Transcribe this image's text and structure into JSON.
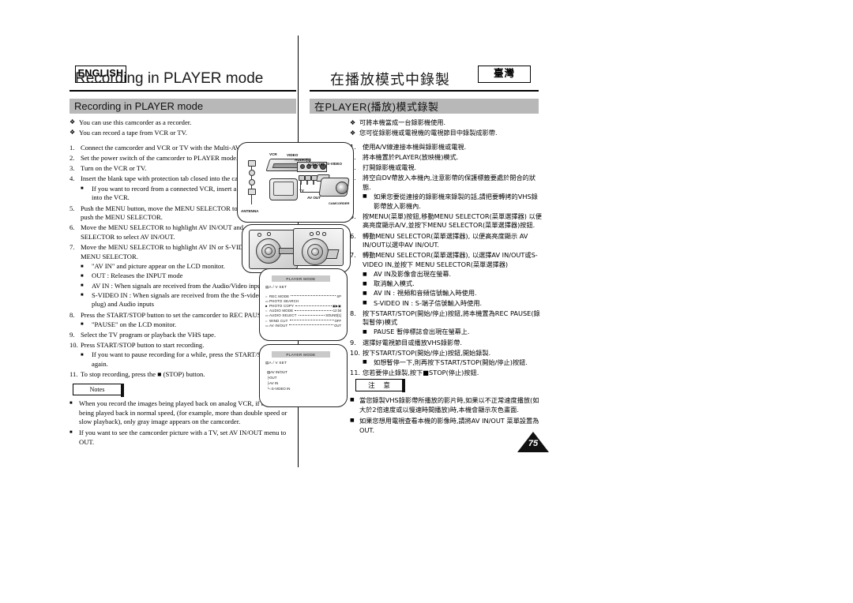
{
  "page": {
    "number": "75",
    "english_badge": "ENGLISH",
    "taiwan_badge": "臺灣"
  },
  "english": {
    "title": "Recording in PLAYER mode",
    "section_bar": "Recording in PLAYER mode",
    "intro_bullets": [
      "You can use this camcorder as a recorder.",
      "You can record a tape from VCR or TV."
    ],
    "steps": [
      {
        "num": "1.",
        "text": "Connect the camcorder and VCR or TV with the Multi-AV cable.",
        "subs": []
      },
      {
        "num": "2.",
        "text": "Set the power switch of the camcorder to PLAYER mode.",
        "subs": []
      },
      {
        "num": "3.",
        "text": "Turn on the VCR or TV.",
        "subs": []
      },
      {
        "num": "4.",
        "text": "Insert the blank tape with protection tab closed into the camcorder.",
        "subs": [
          "If you want to record from a connected VCR, insert a recorded VHS tape into the VCR."
        ]
      },
      {
        "num": "5.",
        "text": "Push the MENU button, move the MENU SELECTOR to highlight A/V and push the MENU SELECTOR.",
        "subs": []
      },
      {
        "num": "6.",
        "text": "Move the MENU SELECTOR to highlight AV IN/OUT and push the MENU SELECTOR to select AV IN/OUT.",
        "subs": []
      },
      {
        "num": "7.",
        "text": "Move the MENU SELECTOR to highlight AV IN or S-VIDEO IN and push the MENU SELECTOR.",
        "subs": [
          "\"AV IN\" and picture appear on the LCD monitor.",
          "OUT : Releases the INPUT mode",
          "AV IN : When signals are received from the Audio/Video input jacks",
          "S-VIDEO IN : When signals are received from the the S-video (S-Jack plug) and Audio inputs"
        ]
      },
      {
        "num": "8.",
        "text": "Press the START/STOP button to set the camcorder to REC PAUSE mode.",
        "subs": [
          "\"PAUSE\" on the LCD monitor."
        ]
      },
      {
        "num": "9.",
        "text": "Select the TV program or playback the VHS tape.",
        "subs": []
      },
      {
        "num": "10.",
        "text": "Press START/STOP button to start recording.",
        "subs": [
          "If you want to pause recording for a while, press the START/STOP button again."
        ]
      },
      {
        "num": "11.",
        "text": "To stop recording, press the ■ (STOP) button.",
        "subs": []
      }
    ],
    "notes_label": "Notes",
    "notes": [
      "When you record the images being played back on analog VCR, if they are not being played back in normal speed, (for example, more than double speed or slow playback), only gray image appears on the camcorder.",
      "If you want to see the camcorder picture with a TV, set AV IN/OUT menu to OUT."
    ]
  },
  "chinese": {
    "title": "在播放模式中錄製",
    "section_bar": "在PLAYER(播放)模式錄製",
    "intro_bullets": [
      "可將本機當成一台錄影機使用.",
      "您可從錄影機或電視機的電視節目中錄製成影帶."
    ],
    "steps": [
      {
        "num": "1.",
        "text": "使用A/V線連接本機與錄影機或電視.",
        "subs": []
      },
      {
        "num": "2.",
        "text": "將本機置於PLAYER(放映機)模式.",
        "subs": []
      },
      {
        "num": "3.",
        "text": "打開錄影機或電視.",
        "subs": []
      },
      {
        "num": "4.",
        "text": "將空白DV帶放入本機內,注意影帶的保護標籤要處於閉合的狀態.",
        "subs": [
          "如果您要從連接的錄影機來錄製的話,請把要轉拷的VHS錄影帶放入影機內."
        ]
      },
      {
        "num": "5.",
        "text": "按MENU(菜單)按鈕,移動MENU SELECTOR(菜單選擇器) 以便高亮度顯示A/V,並按下MENU SELECTOR(菜單選擇器)按鈕.",
        "subs": []
      },
      {
        "num": "6.",
        "text": "轉動MENU SELECTOR(菜單選擇器), 以便高亮度顯示 AV IN/OUT以選中AV IN/OUT.",
        "subs": []
      },
      {
        "num": "7.",
        "text": "轉動MENU SELECTOR(菜單選擇器), 以選擇AV IN/OUT或S-VIDEO IN,並按下 MENU SELECTOR(菜單選擇器)",
        "subs": [
          "AV IN及影像會出現在螢幕.",
          "取消輸入模式.",
          "AV IN : 視頻和音頻信號輸入時使用.",
          "S-VIDEO IN : S-端子信號輸入時使用."
        ]
      },
      {
        "num": "8.",
        "text": "按下START/STOP(開始/停止)按鈕,將本機置為REC PAUSE(錄製暫停)模式",
        "subs": [
          "PAUSE 暫停標誌會出現在螢幕上."
        ]
      },
      {
        "num": "9.",
        "text": "選擇好電視節目或播放VHS錄影帶.",
        "subs": []
      },
      {
        "num": "10.",
        "text": "按下START/STOP(開始/停止)按鈕,開始錄製.",
        "subs": [
          "如想暫停一下,則再按下START/STOP(開始/停止)按鈕."
        ]
      },
      {
        "num": "11.",
        "text": "您若要停止錄製,按下■STOP(停止)按鈕.",
        "subs": []
      }
    ],
    "notes_label": "注 意",
    "notes": [
      "當您錄製VHS錄影帶所播放的影片時,如果以不正常速度播放(如大於2倍速度或以慢速時間播放)時,本機會顯示灰色畫面.",
      "如果您想用電視查看本機的影像時,請將AV IN/OUT 菜單設置為OUT."
    ]
  },
  "diagram_connection": {
    "labels": {
      "vcr": "VCR",
      "tv": "TV",
      "video": "VIDEO",
      "audio_l": "AUDIO(L)",
      "audio_r": "AUDIO(R)",
      "s_video": "S-VIDEO",
      "av_out": "AV OUT",
      "camcorder": "CAMCORDER",
      "antenna": "ANTENNA"
    }
  },
  "lcd_screen_1": {
    "title": "PLAYER MODE",
    "submenu": "A / V SET",
    "rows": [
      {
        "icon": "○",
        "name": "REC MODE",
        "value": "SP"
      },
      {
        "icon": "▭",
        "name": "PHOTO SEARCH",
        "value": ""
      },
      {
        "icon": "■",
        "name": "PHOTO COPY",
        "value": "▣▶▣"
      },
      {
        "icon": "○",
        "name": "AUDIO MODE",
        "value": "12 bit"
      },
      {
        "icon": "▭",
        "name": "AUDIO SELECT",
        "value": "SOUND[1]"
      },
      {
        "icon": "○",
        "name": "WIND CUT",
        "value": "OFF"
      },
      {
        "icon": "▭",
        "name": "AV IN/OUT",
        "value": "OUT"
      }
    ]
  },
  "lcd_screen_2": {
    "title": "PLAYER MODE",
    "submenu": "A / V SET",
    "group": "AV IN/OUT",
    "options": [
      "OUT",
      "AV IN",
      "S-VIDEO IN"
    ]
  }
}
